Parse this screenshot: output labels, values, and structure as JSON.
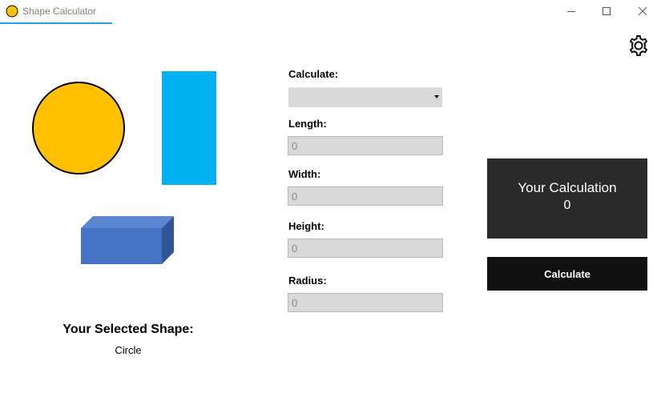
{
  "window": {
    "title": "Shape Calculator",
    "app_icon": "yellow-circle-icon"
  },
  "settings": {
    "icon": "gear-icon"
  },
  "shapes": {
    "circle_color": "#FFC000",
    "rectangle_color": "#00B0F0",
    "box_color": "#4472C4"
  },
  "selected_shape": {
    "heading": "Your Selected Shape:",
    "value": "Circle"
  },
  "form": {
    "calculate_label": "Calculate:",
    "calculate_value": "",
    "length_label": "Length:",
    "length_value": "0",
    "width_label": "Width:",
    "width_value": "0",
    "height_label": "Height:",
    "height_value": "0",
    "radius_label": "Radius:",
    "radius_value": "0"
  },
  "result": {
    "heading": "Your Calculation",
    "value": "0"
  },
  "calculate_button": {
    "label": "Calculate"
  },
  "colors": {
    "accent": "#2B9FD8",
    "result_panel": "#2B2B2B",
    "button": "#111111",
    "input": "#D9D9D9"
  }
}
